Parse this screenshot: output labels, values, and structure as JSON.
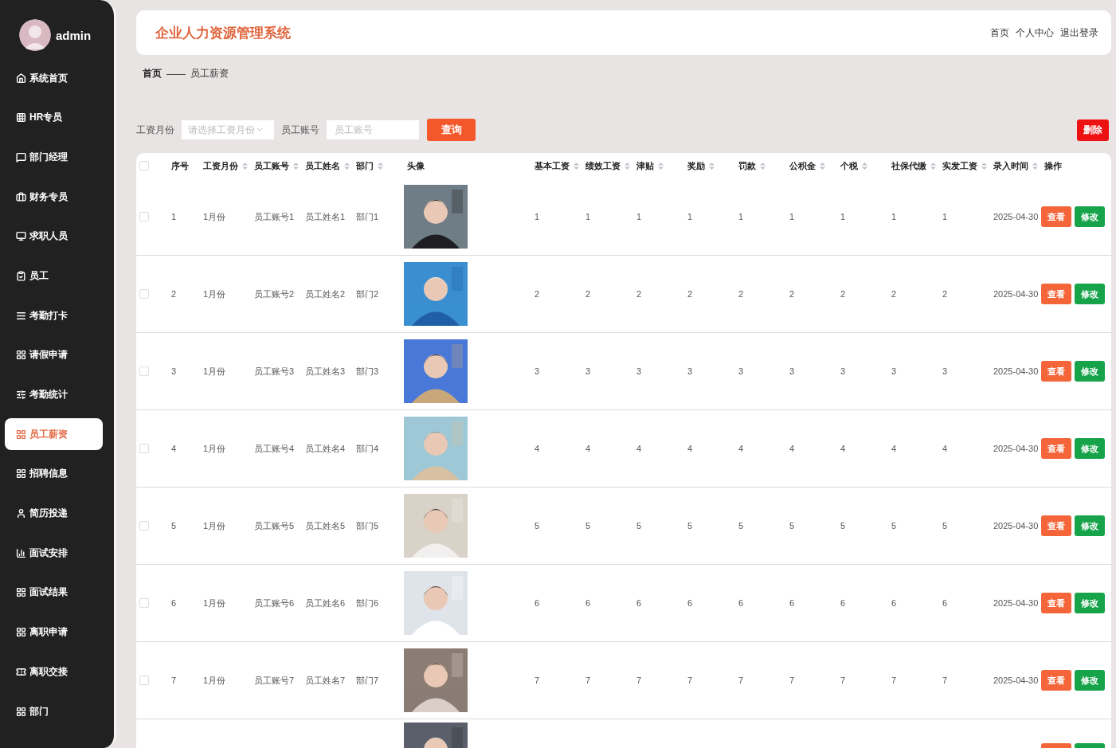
{
  "sidebar": {
    "user": "admin",
    "items": [
      {
        "label": "系统首页",
        "selected": false
      },
      {
        "label": "HR专员",
        "selected": false
      },
      {
        "label": "部门经理",
        "selected": false
      },
      {
        "label": "财务专员",
        "selected": false
      },
      {
        "label": "求职人员",
        "selected": false
      },
      {
        "label": "员工",
        "selected": false
      },
      {
        "label": "考勤打卡",
        "selected": false
      },
      {
        "label": "请假申请",
        "selected": false
      },
      {
        "label": "考勤统计",
        "selected": false
      },
      {
        "label": "员工薪资",
        "selected": true
      },
      {
        "label": "招聘信息",
        "selected": false
      },
      {
        "label": "简历投递",
        "selected": false
      },
      {
        "label": "面试安排",
        "selected": false
      },
      {
        "label": "面试结果",
        "selected": false
      },
      {
        "label": "离职申请",
        "selected": false
      },
      {
        "label": "离职交接",
        "selected": false
      },
      {
        "label": "部门",
        "selected": false
      }
    ]
  },
  "header": {
    "title": "企业人力资源管理系统",
    "links": [
      "首页",
      "个人中心",
      "退出登录"
    ]
  },
  "breadcrumb": {
    "home": "首页",
    "separator": "——",
    "current": "员工薪资"
  },
  "filters": {
    "month_label": "工资月份",
    "month_placeholder": "请选择工资月份",
    "account_label": "员工账号",
    "account_placeholder": "员工账号",
    "search_button": "查询",
    "delete_button": "删除"
  },
  "table": {
    "header_checked": false,
    "columns": [
      {
        "label": "序号",
        "sortable": false
      },
      {
        "label": "工资月份",
        "sortable": true
      },
      {
        "label": "员工账号",
        "sortable": true
      },
      {
        "label": "员工姓名",
        "sortable": true
      },
      {
        "label": "部门",
        "sortable": true
      },
      {
        "label": "头像",
        "sortable": false
      },
      {
        "label": "基本工资",
        "sortable": true
      },
      {
        "label": "绩效工资",
        "sortable": true
      },
      {
        "label": "津贴",
        "sortable": true
      },
      {
        "label": "奖励",
        "sortable": true
      },
      {
        "label": "罚款",
        "sortable": true
      },
      {
        "label": "公积金",
        "sortable": true
      },
      {
        "label": "个税",
        "sortable": true
      },
      {
        "label": "社保代缴",
        "sortable": true
      },
      {
        "label": "实发工资",
        "sortable": true
      },
      {
        "label": "录入时间",
        "sortable": true
      },
      {
        "label": "操作",
        "sortable": false
      }
    ],
    "rows": [
      {
        "checked": false,
        "cells": [
          "1",
          "1月份",
          "员工账号1",
          "员工姓名1",
          "部门1",
          {
            "kind": "picture"
          },
          "1",
          "1",
          "1",
          "1",
          "1",
          "1",
          "1",
          "1",
          "1",
          "2025-04-30"
        ],
        "actions": [
          "查看",
          "修改"
        ]
      },
      {
        "checked": false,
        "cells": [
          "2",
          "1月份",
          "员工账号2",
          "员工姓名2",
          "部门2",
          {
            "kind": "picture"
          },
          "2",
          "2",
          "2",
          "2",
          "2",
          "2",
          "2",
          "2",
          "2",
          "2025-04-30"
        ],
        "actions": [
          "查看",
          "修改"
        ]
      },
      {
        "checked": false,
        "cells": [
          "3",
          "1月份",
          "员工账号3",
          "员工姓名3",
          "部门3",
          {
            "kind": "picture"
          },
          "3",
          "3",
          "3",
          "3",
          "3",
          "3",
          "3",
          "3",
          "3",
          "2025-04-30"
        ],
        "actions": [
          "查看",
          "修改"
        ]
      },
      {
        "checked": false,
        "cells": [
          "4",
          "1月份",
          "员工账号4",
          "员工姓名4",
          "部门4",
          {
            "kind": "picture"
          },
          "4",
          "4",
          "4",
          "4",
          "4",
          "4",
          "4",
          "4",
          "4",
          "2025-04-30"
        ],
        "actions": [
          "查看",
          "修改"
        ]
      },
      {
        "checked": false,
        "cells": [
          "5",
          "1月份",
          "员工账号5",
          "员工姓名5",
          "部门5",
          {
            "kind": "picture"
          },
          "5",
          "5",
          "5",
          "5",
          "5",
          "5",
          "5",
          "5",
          "5",
          "2025-04-30"
        ],
        "actions": [
          "查看",
          "修改"
        ]
      },
      {
        "checked": false,
        "cells": [
          "6",
          "1月份",
          "员工账号6",
          "员工姓名6",
          "部门6",
          {
            "kind": "picture"
          },
          "6",
          "6",
          "6",
          "6",
          "6",
          "6",
          "6",
          "6",
          "6",
          "2025-04-30"
        ],
        "actions": [
          "查看",
          "修改"
        ]
      },
      {
        "checked": false,
        "cells": [
          "7",
          "1月份",
          "员工账号7",
          "员工姓名7",
          "部门7",
          {
            "kind": "picture"
          },
          "7",
          "7",
          "7",
          "7",
          "7",
          "7",
          "7",
          "7",
          "7",
          "2025-04-30"
        ],
        "actions": [
          "查看",
          "修改"
        ]
      }
    ],
    "partial_row": {
      "avatar": {
        "kind": "picture"
      }
    }
  }
}
